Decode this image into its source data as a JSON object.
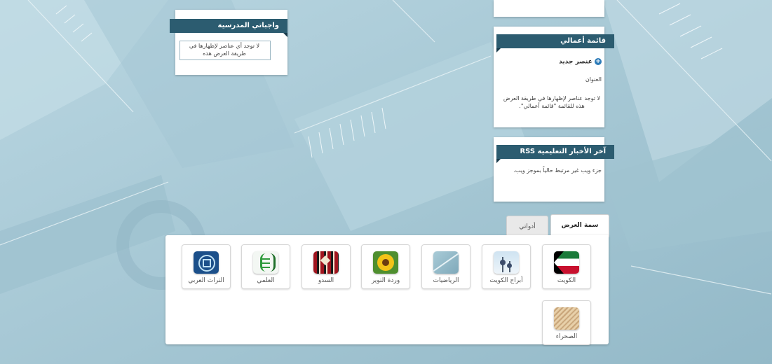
{
  "widgets": {
    "school_duties": {
      "title": "واجباتي المدرسية",
      "empty_text": "لا توجد أي عناصر لإظهارها في طريقة العرض هذه"
    },
    "my_tasks": {
      "title": "قائمة أعمالي",
      "new_item": "عنصر جديد",
      "column_title": "العنوان",
      "empty_text": "لا توجد عناصر لإظهارها في طريقة العرض هذه للقائمة \"قائمة أعمالي\"."
    },
    "rss": {
      "title": "آخر الأخبار التعليمية RSS",
      "text": "جزء ويب غير مرتبط حالياً بموجز ويب."
    }
  },
  "tabs": [
    {
      "label": "سمة العرض",
      "active": true
    },
    {
      "label": "أدواتي",
      "active": false
    }
  ],
  "themes": [
    {
      "label": "الكويت",
      "icon": "kuwait-flag-icon"
    },
    {
      "label": "أبراج الكويت",
      "icon": "kuwait-towers-icon"
    },
    {
      "label": "الرياضيات",
      "icon": "math-icon"
    },
    {
      "label": "وردة التوير",
      "icon": "sunflower-icon"
    },
    {
      "label": "السدو",
      "icon": "sadu-pattern-icon"
    },
    {
      "label": "العلمي",
      "icon": "dna-icon"
    },
    {
      "label": "التراث العربي",
      "icon": "arabic-heritage-icon"
    },
    {
      "label": "الصحراء",
      "icon": "desert-icon"
    }
  ],
  "colors": {
    "background": "#a9cad6",
    "title_bar": "#2c5c70",
    "panel": "#ffffff"
  }
}
